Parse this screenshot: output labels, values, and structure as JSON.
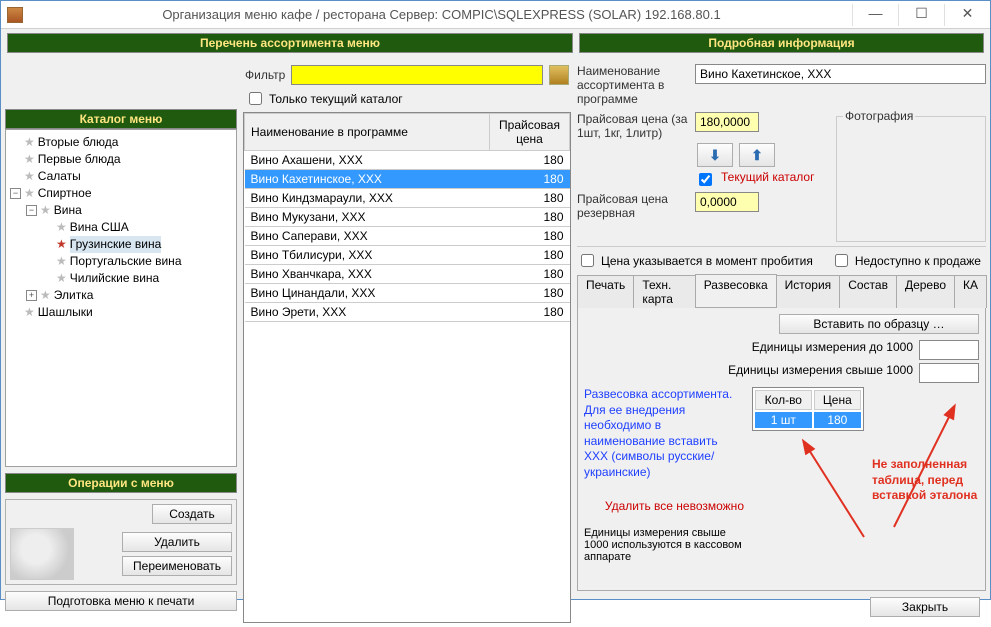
{
  "window": {
    "title": "Организация меню кафе / ресторана  Сервер: COMPIC\\SQLEXPRESS (SOLAR) 192.168.80.1",
    "min": "—",
    "max": "☐",
    "close": "✕"
  },
  "headers": {
    "left_panel": "Перечень ассортимента меню",
    "catalog": "Каталог меню",
    "ops": "Операции с меню",
    "right_panel": "Подробная информация"
  },
  "filter": {
    "label": "Фильтр",
    "value": "",
    "only_current": "Только текущий каталог"
  },
  "tree": {
    "n0": "Вторые блюда",
    "n1": "Первые блюда",
    "n2": "Салаты",
    "n3": "Спиртное",
    "n4": "Вина",
    "n5": "Вина США",
    "n6": "Грузинские вина",
    "n7": "Португальские вина",
    "n8": "Чилийские вина",
    "n9": "Элитка",
    "n10": "Шашлыки"
  },
  "ops": {
    "create": "Создать",
    "delete": "Удалить",
    "rename": "Переименовать",
    "print": "Подготовка меню к печати"
  },
  "grid": {
    "col_name": "Наименование в программе",
    "col_price": "Прайсовая цена",
    "rows": [
      {
        "name": "Вино Ахашени, ХХХ",
        "price": "180"
      },
      {
        "name": "Вино Кахетинское, ХХХ",
        "price": "180"
      },
      {
        "name": "Вино Киндзмараули, ХХХ",
        "price": "180"
      },
      {
        "name": "Вино Мукузани, ХХХ",
        "price": "180"
      },
      {
        "name": "Вино Саперави, ХХХ",
        "price": "180"
      },
      {
        "name": "Вино Тбилисури, ХХХ",
        "price": "180"
      },
      {
        "name": "Вино Хванчкара, ХХХ",
        "price": "180"
      },
      {
        "name": "Вино Цинандали, ХХХ",
        "price": "180"
      },
      {
        "name": "Вино Эрети, ХХХ",
        "price": "180"
      }
    ]
  },
  "detail": {
    "name_label": "Наименование ассортимента в программе",
    "name_value": "Вино Кахетинское, ХХХ",
    "photo_legend": "Фотография",
    "price_label": "Прайсовая цена (за 1шт, 1кг, 1литр)",
    "price_value": "180,0000",
    "current_catalog": "Текущий каталог",
    "reserve_label": "Прайсовая цена резервная",
    "reserve_value": "0,0000",
    "price_at_sale": "Цена указывается в момент пробития",
    "not_for_sale": "Недоступно к продаже"
  },
  "tabs": {
    "t0": "Печать",
    "t1": "Техн. карта",
    "t2": "Развесовка",
    "t3": "История",
    "t4": "Состав",
    "t5": "Дерево",
    "t6": "КА"
  },
  "weigh": {
    "insert_btn": "Вставить по образцу …",
    "unit_lt": "Единицы измерения до 1000",
    "unit_gt": "Единицы измерения свыше 1000",
    "blue_note": "Развесовка ассортимента. Для ее внедрения необходимо в наименование вставить  ХХХ (символы русские/украинские)",
    "del_all": "Удалить все невозможно",
    "bottom_note": "Единицы измерения свыше 1000 используются в кассовом аппарате",
    "col_qty": "Кол-во",
    "col_price": "Цена",
    "row_qty": "1 шт",
    "row_price": "180",
    "red_note": "Не заполненная таблица, перед вставкой эталона"
  },
  "footer": {
    "close": "Закрыть"
  }
}
